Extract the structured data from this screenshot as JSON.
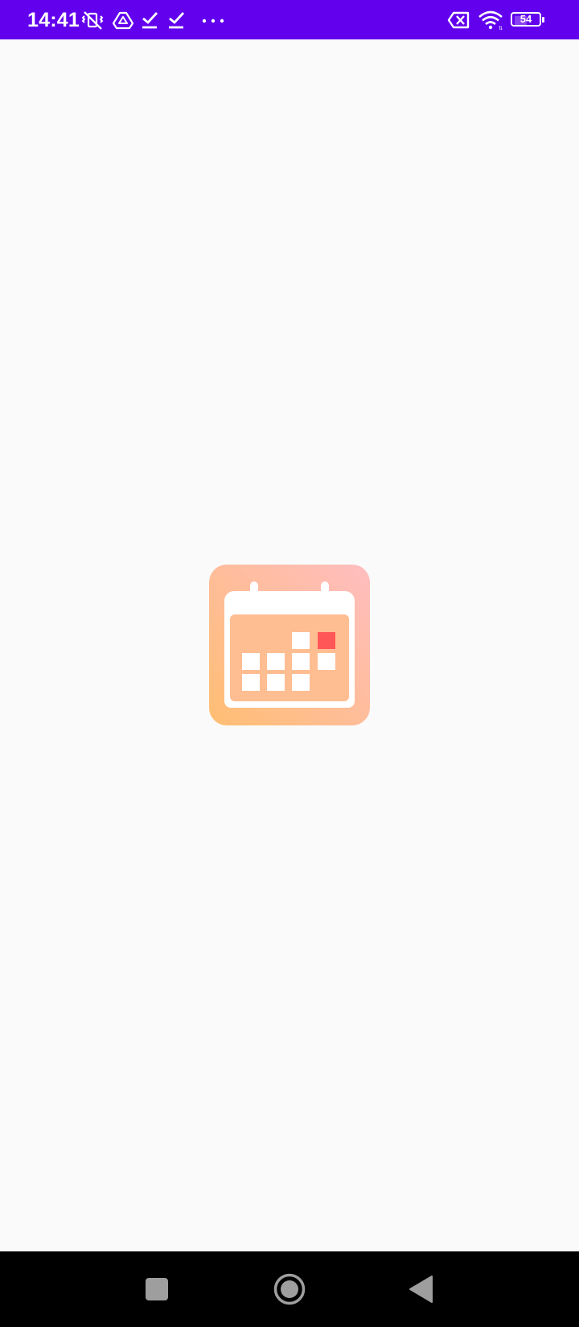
{
  "status_bar": {
    "time": "14:41",
    "battery_level": "54",
    "battery_fraction": 0.54,
    "background_color": "#6200ee",
    "icons": [
      "vibrate-off-icon",
      "drive-icon",
      "check-icon",
      "check-icon",
      "more-dots-icon",
      "sim-x-icon",
      "wifi-icon",
      "battery-icon"
    ]
  },
  "splash": {
    "logo_icon": "calendar-app-icon",
    "gradient": [
      "#ffbdc0",
      "#ffbd9a",
      "#ffbe72"
    ],
    "highlight_color": "#ff5757"
  },
  "nav_bar": {
    "buttons": [
      "recents-button",
      "home-button",
      "back-button"
    ]
  }
}
